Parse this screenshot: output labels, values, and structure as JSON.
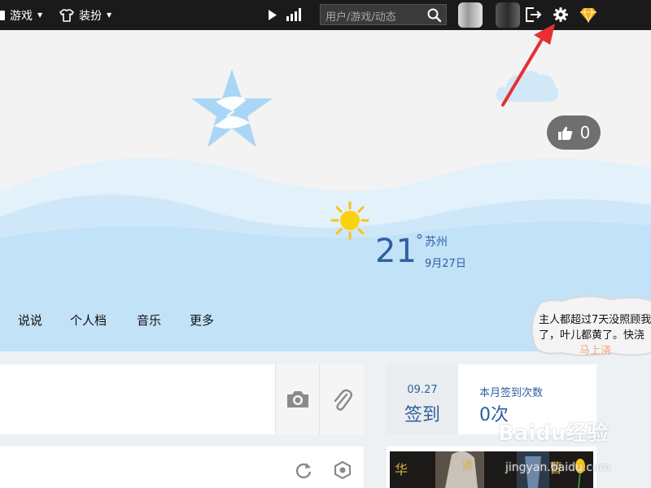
{
  "topbar": {
    "games_label": "游戏",
    "dress_label": "装扮",
    "search_placeholder": "用户/游戏/动态"
  },
  "hero": {
    "like_count": "0",
    "weather": {
      "temp": "21",
      "degree": "°",
      "city": "苏州",
      "date": "9月27日"
    }
  },
  "nav": {
    "tabs": [
      "说说",
      "个人档",
      "音乐",
      "更多"
    ]
  },
  "bubble": {
    "line1": "主人都超过7天没照顾我",
    "line2": "了，叶儿都黄了。快浇",
    "link": "马上浇"
  },
  "checkin": {
    "date": "09.27",
    "label": "签到",
    "month_title": "本月签到次数",
    "month_count": "0次"
  },
  "watermark": {
    "brand": "Baidu经验",
    "url": "jingyan.baidu.com"
  },
  "colors": {
    "accent": "#2f5f9e",
    "topbar": "#1a1a1a",
    "sky": "#c7e4f8",
    "arrow": "#e63030"
  }
}
